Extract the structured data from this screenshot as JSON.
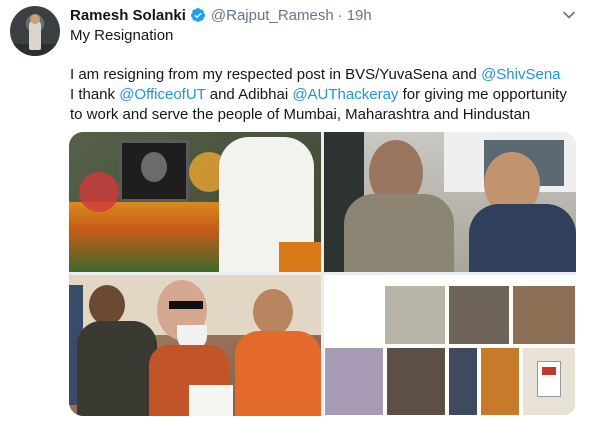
{
  "tweet": {
    "author_name": "Ramesh Solanki",
    "handle": "@Rajput_Ramesh",
    "separator": "·",
    "timestamp": "19h",
    "title": "My Resignation",
    "body": {
      "line1_text": "I am resigning from my respected post in BVS/YuvaSena and ",
      "line1_mention": "@ShivSena",
      "line2_text_a": "I thank ",
      "line2_mention_a": "@OfficeofUT",
      "line2_text_b": " and Adibhai ",
      "line2_mention_b": "@AUThackeray",
      "line2_text_c": " for giving me opportunity",
      "line3_text": "to work and serve the people of Mumbai, Maharashtra and  Hindustan"
    }
  },
  "icons": {
    "verified": "verified-badge-icon",
    "menu": "chevron-down-icon"
  },
  "colors": {
    "link": "#1b95e0",
    "secondary_text": "#657786",
    "primary_text": "#14171a",
    "verified_badge": "#1da1f2"
  }
}
